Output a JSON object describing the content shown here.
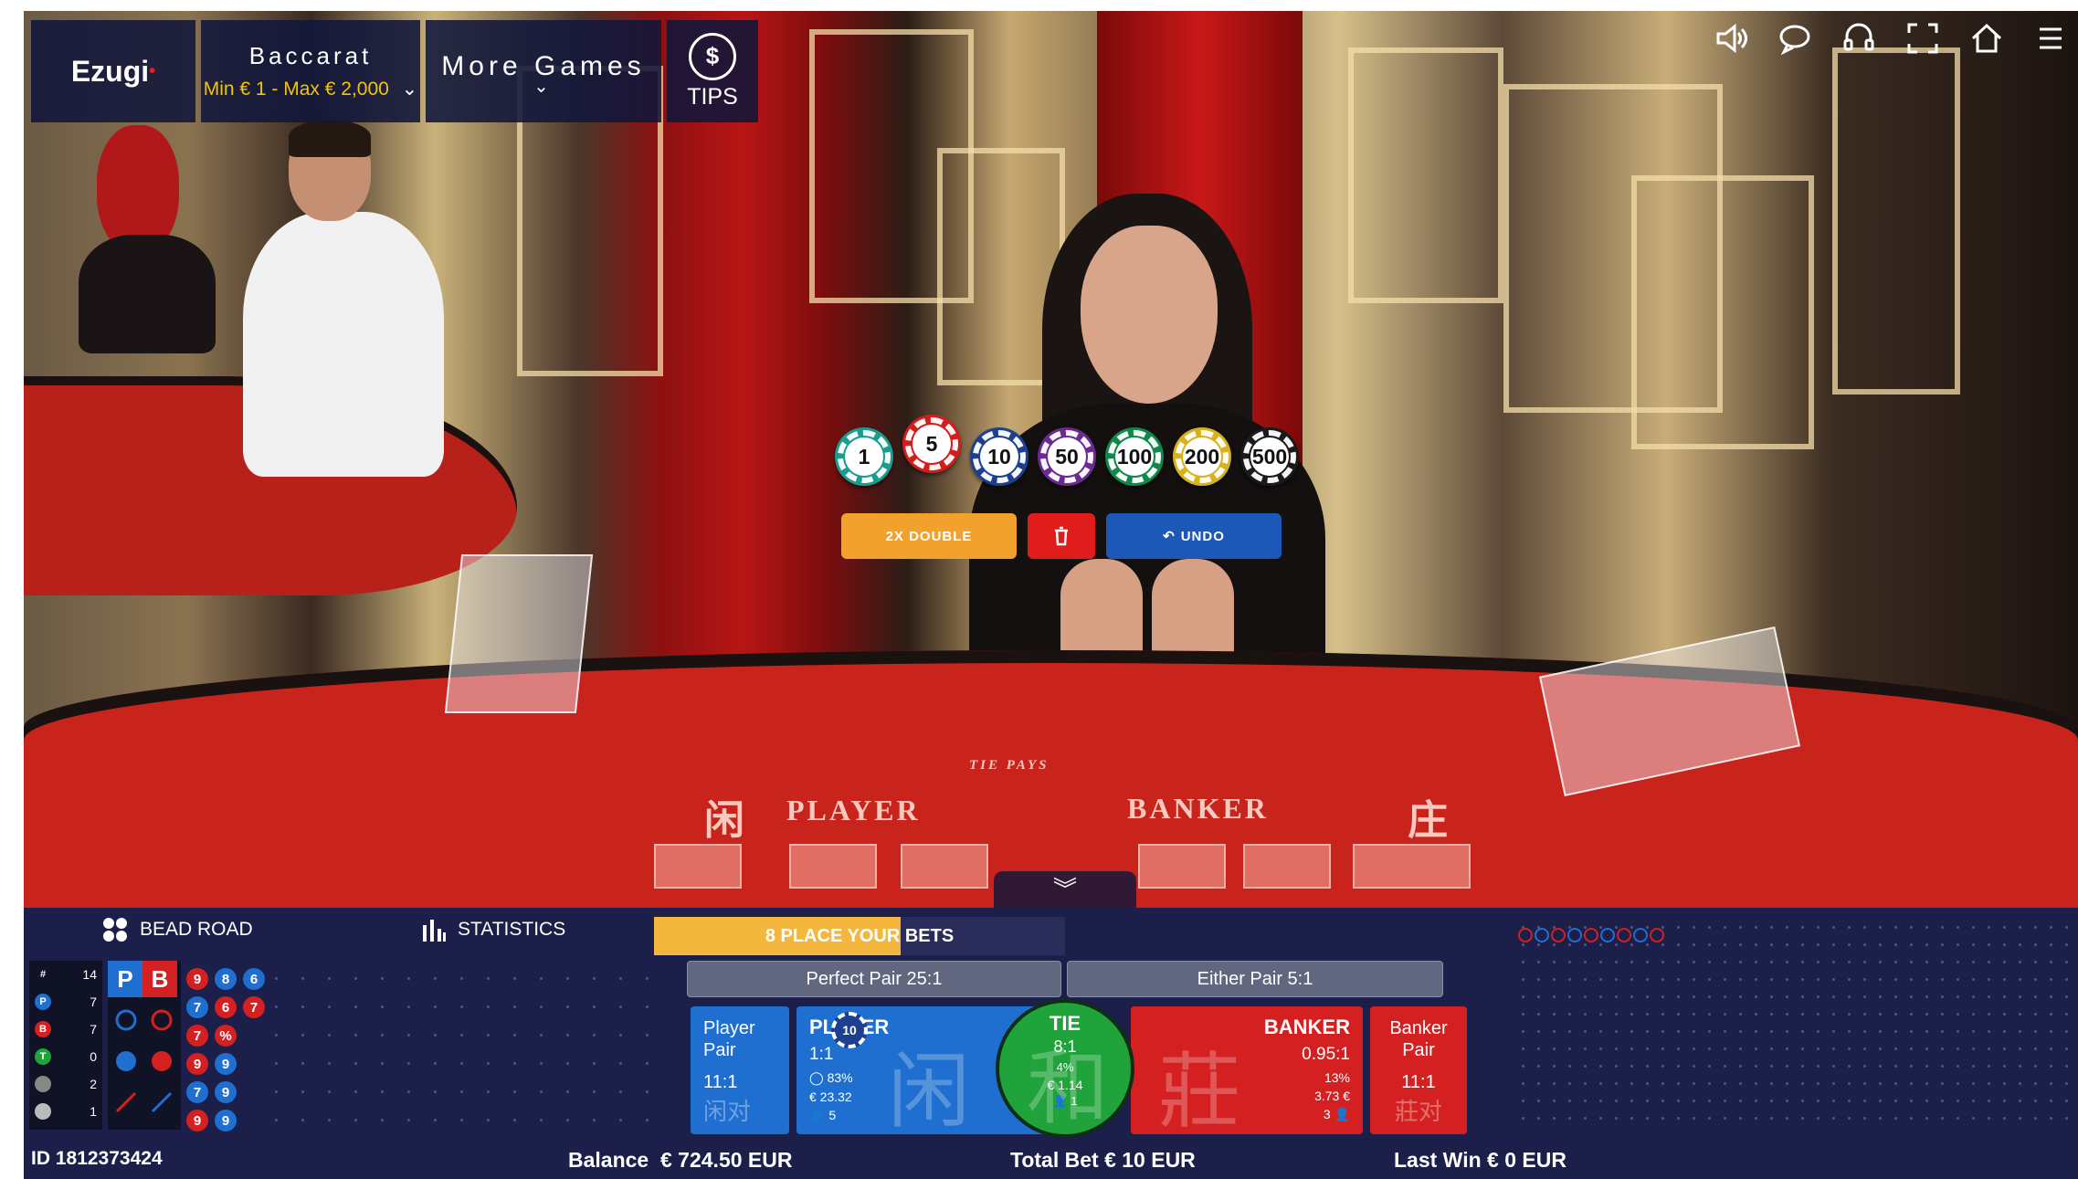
{
  "header": {
    "logo": "Ezugi",
    "game_name": "Baccarat",
    "limits": "Min € 1 - Max € 2,000",
    "more_games": "More Games",
    "tips": "TIPS"
  },
  "table_text": {
    "player_cn": "闲",
    "player": "PLAYER",
    "banker": "BANKER",
    "banker_cn": "庄",
    "tie_pays": "TIE PAYS"
  },
  "chips": [
    {
      "value": "1",
      "color": "#1a9c8e"
    },
    {
      "value": "5",
      "color": "#d31c1c"
    },
    {
      "value": "10",
      "color": "#1c3f8f"
    },
    {
      "value": "50",
      "color": "#6a2a90"
    },
    {
      "value": "100",
      "color": "#12874a"
    },
    {
      "value": "200",
      "color": "#d8b21b"
    },
    {
      "value": "500",
      "color": "#1a1a1a"
    }
  ],
  "actions": {
    "double": "2X DOUBLE",
    "undo": "UNDO"
  },
  "bead_road": {
    "title": "BEAD ROAD",
    "statistics": "STATISTICS",
    "counts": [
      {
        "label": "#",
        "value": "14",
        "color": "#101226"
      },
      {
        "label": "P",
        "value": "7",
        "color": "#1f6fd0"
      },
      {
        "label": "B",
        "value": "7",
        "color": "#d42020"
      },
      {
        "label": "T",
        "value": "0",
        "color": "#1fa33a"
      },
      {
        "label": "",
        "value": "2",
        "color": "#888888"
      },
      {
        "label": "",
        "value": "1",
        "color": "#bbbbbb"
      }
    ],
    "pb_head": [
      "P",
      "B"
    ],
    "beads": [
      {
        "v": "9",
        "c": "#d42020"
      },
      {
        "v": "8",
        "c": "#1f6fd0"
      },
      {
        "v": "6",
        "c": "#1f6fd0"
      },
      {
        "v": "7",
        "c": "#1f6fd0"
      },
      {
        "v": "6",
        "c": "#d42020"
      },
      {
        "v": "7",
        "c": "#d42020"
      },
      {
        "v": "7",
        "c": "#d42020"
      },
      {
        "v": "%",
        "c": "#d42020"
      },
      {
        "v": "",
        "c": "transparent"
      },
      {
        "v": "9",
        "c": "#d42020"
      },
      {
        "v": "9",
        "c": "#1f6fd0"
      },
      {
        "v": "",
        "c": "transparent"
      },
      {
        "v": "7",
        "c": "#1f6fd0"
      },
      {
        "v": "9",
        "c": "#1f6fd0"
      },
      {
        "v": "",
        "c": "transparent"
      },
      {
        "v": "9",
        "c": "#d42020"
      },
      {
        "v": "9",
        "c": "#1f6fd0"
      },
      {
        "v": "",
        "c": "transparent"
      }
    ]
  },
  "betting": {
    "timer_count": "8",
    "timer_text": "PLACE YOUR BETS",
    "timer_progress": 0.6,
    "perfect_pair": "Perfect Pair 25:1",
    "either_pair": "Either Pair 5:1",
    "player_pair": {
      "title": "Player Pair",
      "odds": "11:1",
      "cn": "闲对"
    },
    "player": {
      "title": "PLAYER",
      "odds": "1:1",
      "pct": "83%",
      "amount": "€ 23.32",
      "users": "5",
      "chip": "10",
      "cn": "闲"
    },
    "tie": {
      "title": "TIE",
      "odds": "8:1",
      "pct": "4%",
      "amount": "€ 1.14",
      "users": "1",
      "cn": "和"
    },
    "banker": {
      "title": "BANKER",
      "odds": "0.95:1",
      "pct": "13%",
      "amount": "3.73 €",
      "users": "3",
      "cn": "莊"
    },
    "banker_pair": {
      "title": "Banker Pair",
      "odds": "11:1",
      "cn": "莊对"
    }
  },
  "status": {
    "id": "ID 1812373424",
    "balance_label": "Balance",
    "balance": "€ 724.50 EUR",
    "total_bet": "Total Bet € 10 EUR",
    "last_win": "Last Win € 0 EUR"
  }
}
